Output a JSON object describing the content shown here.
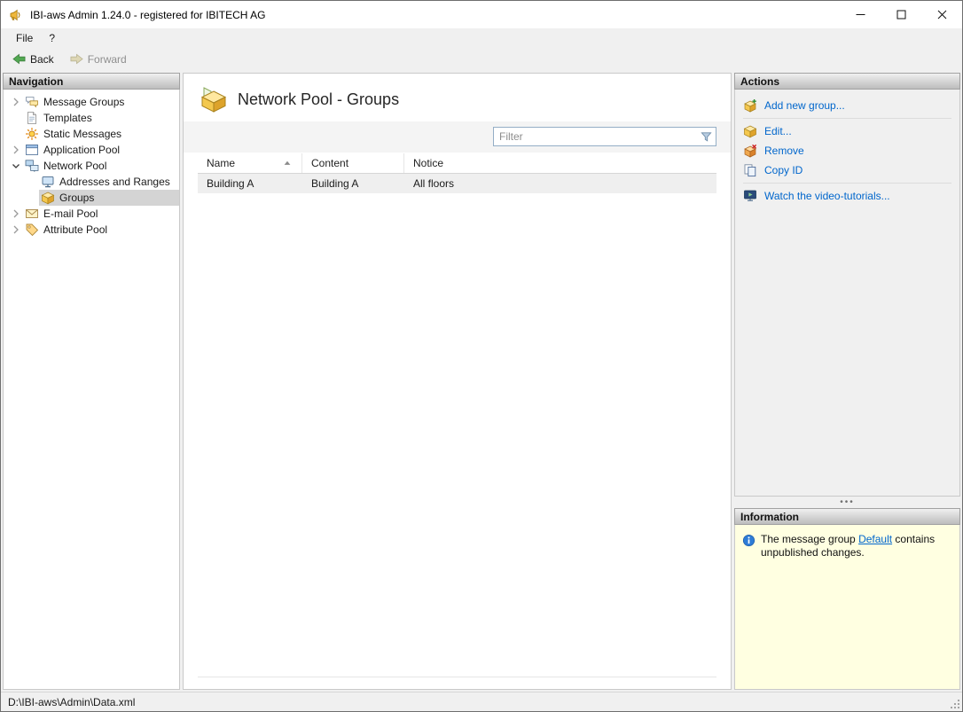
{
  "colors": {
    "link_blue": "#0066cc",
    "info_panel_yellow": "#ffffe1",
    "back_arrow_green": "#52a852",
    "tree_selection_gray": "#d4d4d4"
  },
  "window": {
    "title": "IBI-aws Admin 1.24.0 - registered for IBITECH AG"
  },
  "menubar": {
    "file": "File",
    "help": "?"
  },
  "toolbar": {
    "back_label": "Back",
    "forward_label": "Forward"
  },
  "navigation": {
    "header": "Navigation",
    "items": [
      {
        "label": "Message Groups",
        "state": "collapsed",
        "level": 0
      },
      {
        "label": "Templates",
        "state": "leaf",
        "level": 0
      },
      {
        "label": "Static Messages",
        "state": "leaf",
        "level": 0
      },
      {
        "label": "Application Pool",
        "state": "collapsed",
        "level": 0
      },
      {
        "label": "Network Pool",
        "state": "expanded",
        "level": 0
      },
      {
        "label": "Addresses and Ranges",
        "state": "leaf",
        "level": 1
      },
      {
        "label": "Groups",
        "state": "leaf",
        "level": 1,
        "selected": true
      },
      {
        "label": "E-mail Pool",
        "state": "collapsed",
        "level": 0
      },
      {
        "label": "Attribute Pool",
        "state": "collapsed",
        "level": 0
      }
    ]
  },
  "main": {
    "title": "Network Pool - Groups",
    "filter": {
      "placeholder": "Filter"
    },
    "table": {
      "columns": [
        {
          "label": "Name",
          "sort": "asc"
        },
        {
          "label": "Content",
          "sort": "none"
        },
        {
          "label": "Notice",
          "sort": "none"
        }
      ],
      "rows": [
        {
          "name": "Building A",
          "content": "Building A",
          "notice": "All floors"
        }
      ]
    }
  },
  "actions": {
    "header": "Actions",
    "items": [
      {
        "label": "Add new group..."
      },
      {
        "label": "Edit..."
      },
      {
        "label": "Remove"
      },
      {
        "label": "Copy ID"
      },
      {
        "label": "Watch the video-tutorials..."
      }
    ]
  },
  "information": {
    "header": "Information",
    "text_before": "The message group ",
    "link_label": "Default",
    "text_after": " contains unpublished changes."
  },
  "statusbar": {
    "path": "D:\\IBI-aws\\Admin\\Data.xml"
  }
}
